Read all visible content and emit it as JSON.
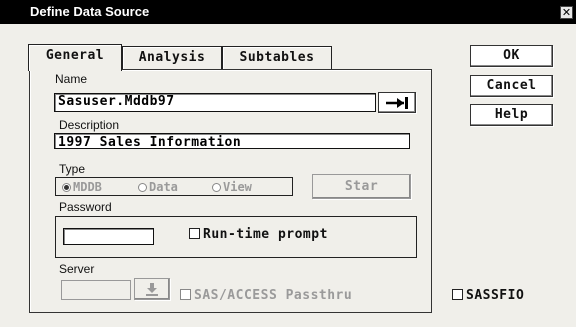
{
  "window": {
    "title": "Define Data Source",
    "close_glyph": "✕"
  },
  "tabs": [
    {
      "label": "General",
      "selected": true
    },
    {
      "label": "Analysis",
      "selected": false
    },
    {
      "label": "Subtables",
      "selected": false
    }
  ],
  "name": {
    "label": "Name",
    "value": "Sasuser.Mddb97"
  },
  "description": {
    "label": "Description",
    "value": "1997 Sales Information"
  },
  "type": {
    "label": "Type",
    "options": [
      {
        "label": "MDDB",
        "selected": true
      },
      {
        "label": "Data",
        "selected": false
      },
      {
        "label": "View",
        "selected": false
      }
    ],
    "star_button": "Star"
  },
  "password": {
    "label": "Password",
    "value": "",
    "runtime_prompt_label": "Run-time prompt",
    "runtime_prompt_checked": false
  },
  "server": {
    "label": "Server",
    "value": "",
    "passthru_label": "SAS/ACCESS Passthru",
    "passthru_checked": false
  },
  "buttons": {
    "ok": "OK",
    "cancel": "Cancel",
    "help": "Help"
  },
  "sassfio": {
    "label": "SASSFIO",
    "checked": false
  },
  "icons": {
    "name_browse": "arrow-to-bar-icon",
    "server_browse": "down-arrow-to-bar-icon"
  }
}
